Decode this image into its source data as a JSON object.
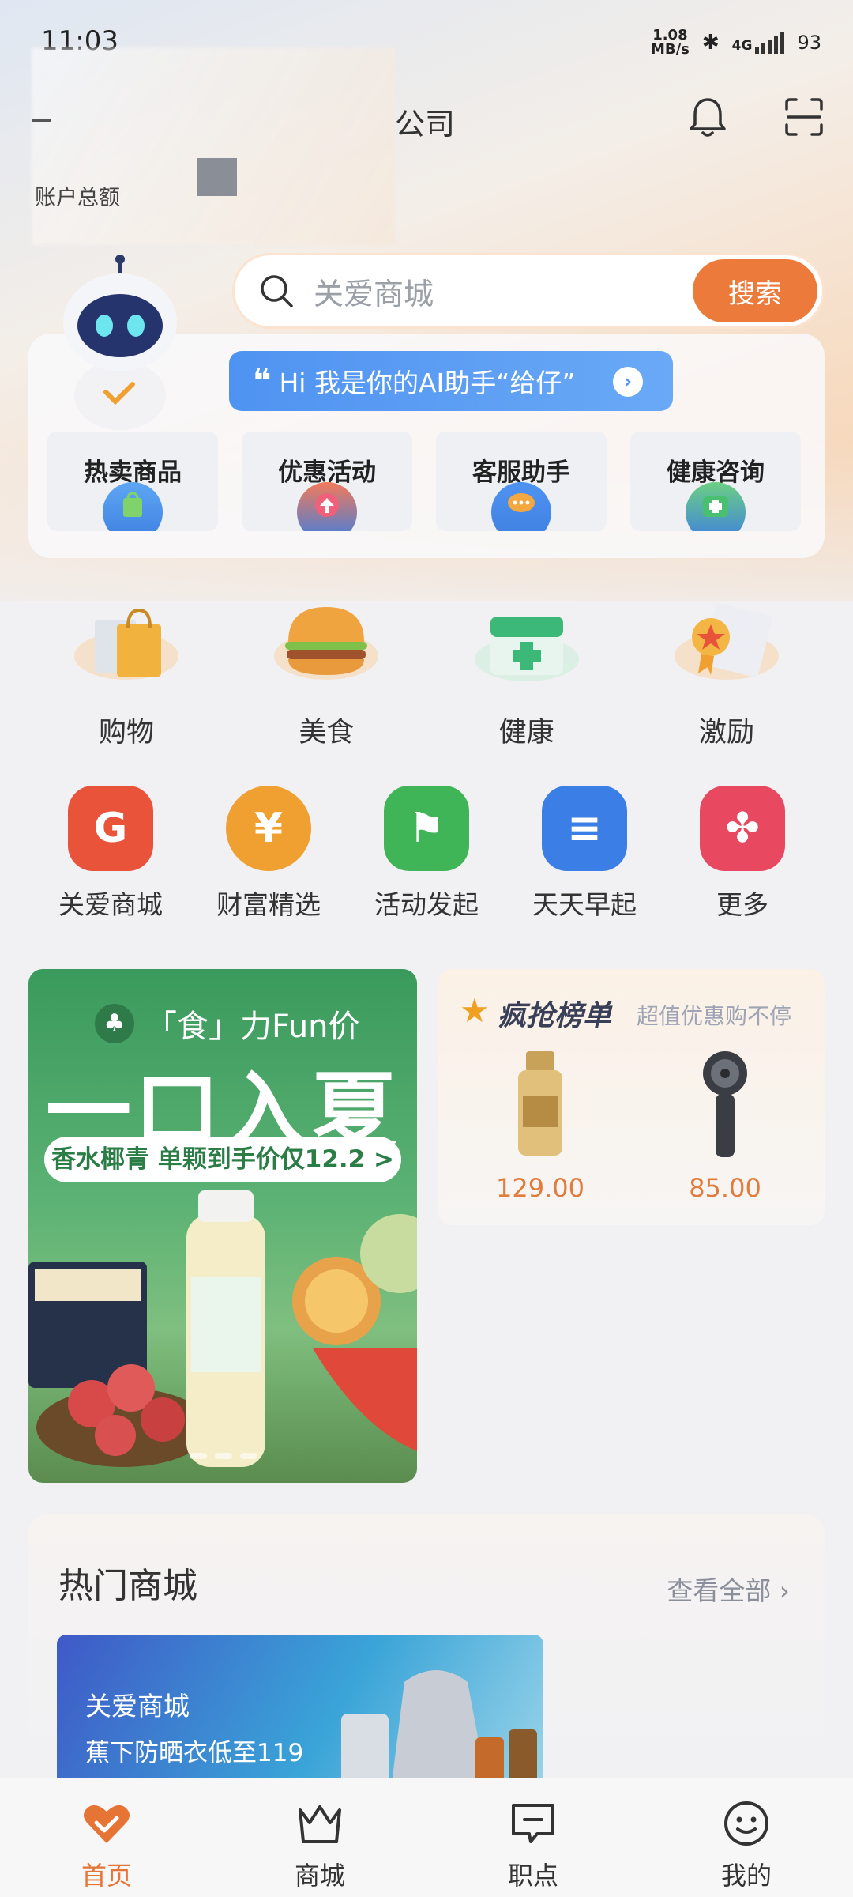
{
  "status_bar": {
    "time": "11:03",
    "net_speed_value": "1.08",
    "net_speed_unit": "MB/s",
    "network": "4G",
    "battery": "93",
    "bluetooth_icon": "bluetooth-icon"
  },
  "header": {
    "company_visible": "公司",
    "balance_label": "账户总额",
    "bell_icon": "bell-icon",
    "scan_icon": "scan-icon"
  },
  "search": {
    "placeholder": "关爱商城",
    "button_label": "搜索"
  },
  "ai_assistant": {
    "bubble_quote": "❝",
    "bubble_text": "Hi 我是你的AI助手“给仔”",
    "cards": [
      {
        "label": "热卖商品",
        "icon": "shopping-bag-icon",
        "color": "#3e8ae8"
      },
      {
        "label": "优惠活动",
        "icon": "upload-arrow-icon",
        "color": "#e8603a"
      },
      {
        "label": "客服助手",
        "icon": "chat-bubble-icon",
        "color": "#f0a030"
      },
      {
        "label": "健康咨询",
        "icon": "medical-kit-icon",
        "color": "#3cb86a"
      }
    ]
  },
  "categories": [
    {
      "label": "购物",
      "icon": "shopping-bag-icon"
    },
    {
      "label": "美食",
      "icon": "hamburger-icon"
    },
    {
      "label": "健康",
      "icon": "medical-box-icon"
    },
    {
      "label": "激励",
      "icon": "certificate-icon"
    }
  ],
  "apps": [
    {
      "label": "关爱商城",
      "glyph": "G",
      "color": "#e8533a"
    },
    {
      "label": "财富精选",
      "glyph": "¥",
      "color": "#f0a030"
    },
    {
      "label": "活动发起",
      "glyph": "⚑",
      "color": "#3fb558"
    },
    {
      "label": "天天早起",
      "glyph": "≡",
      "color": "#3b7fe6"
    },
    {
      "label": "更多",
      "glyph": "✤",
      "color": "#e84860"
    }
  ],
  "banner": {
    "subtitle": "「食」力Fun价",
    "palm_glyph": "♣",
    "title": "一口入夏",
    "pill_text": "香水椰青 单颗到手价仅12.2 >"
  },
  "ranking": {
    "title": "疯抢榜单",
    "subtitle": "超值优惠购不停",
    "products": [
      {
        "price": "129.00",
        "image": "sunscreen-bottle"
      },
      {
        "price": "85.00",
        "image": "handheld-fan"
      }
    ]
  },
  "hot_mall": {
    "title": "热门商城",
    "see_all": "查看全部 ›",
    "banner_title": "关爱商城",
    "banner_sub": "蕉下防晒衣低至119"
  },
  "bottom_nav": [
    {
      "label": "首页",
      "icon": "home-heart-icon",
      "active": true
    },
    {
      "label": "商城",
      "icon": "crown-icon",
      "active": false
    },
    {
      "label": "职点",
      "icon": "message-square-icon",
      "active": false
    },
    {
      "label": "我的",
      "icon": "smiley-icon",
      "active": false
    }
  ],
  "colors": {
    "accent": "#ec7a3a",
    "active_nav": "#e67535",
    "ai_bubble": "#4f93f2"
  }
}
